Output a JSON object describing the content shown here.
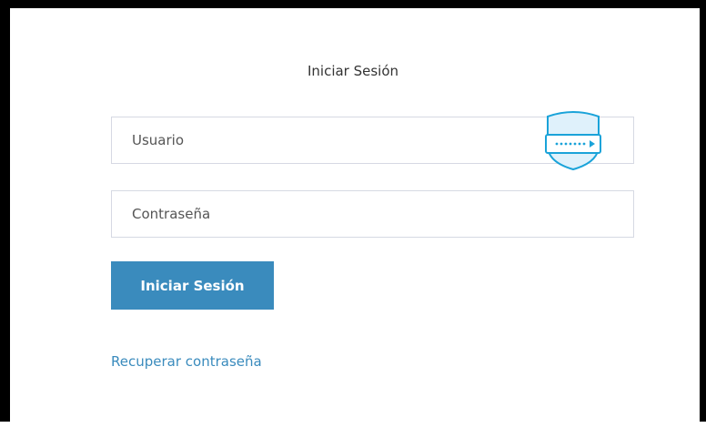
{
  "login": {
    "title": "Iniciar Sesión",
    "username_placeholder": "Usuario",
    "password_placeholder": "Contraseña",
    "submit_label": "Iniciar Sesión",
    "recover_link": "Recuperar contraseña"
  },
  "password_manager": {
    "icon": "shield-key-icon"
  },
  "colors": {
    "accent": "#3a8bbd",
    "border": "#d6d9e3",
    "frame": "#000000",
    "shield_fill": "#dff1fb",
    "shield_stroke": "#1aa3d9"
  }
}
